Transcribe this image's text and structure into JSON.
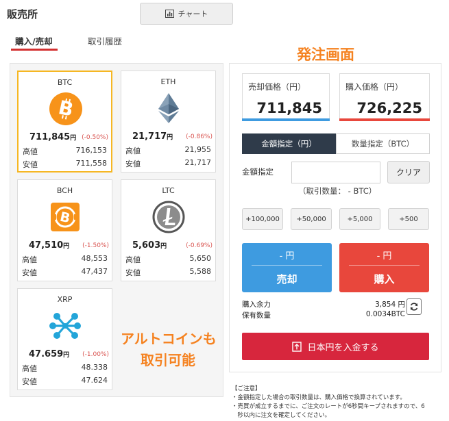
{
  "header": {
    "title": "販売所",
    "chart_button_label": "チャート"
  },
  "tabs": [
    {
      "label": "購入/売却",
      "active": true
    },
    {
      "label": "取引履歴",
      "active": false
    }
  ],
  "annotations": {
    "order_screen": "発注画面",
    "altcoin_line1": "アルトコインも",
    "altcoin_line2": "取引可能"
  },
  "coins": [
    {
      "symbol": "BTC",
      "price": "711,845",
      "unit": "円",
      "change": "(-0.50%)",
      "high_label": "高値",
      "high": "716,153",
      "low_label": "安値",
      "low": "711,558",
      "selected": true,
      "icon": "bitcoin-icon"
    },
    {
      "symbol": "ETH",
      "price": "21,717",
      "unit": "円",
      "change": "(-0.86%)",
      "high_label": "高値",
      "high": "21,955",
      "low_label": "安値",
      "low": "21,717",
      "selected": false,
      "icon": "ethereum-icon"
    },
    {
      "symbol": "BCH",
      "price": "47,510",
      "unit": "円",
      "change": "(-1.50%)",
      "high_label": "高値",
      "high": "48,553",
      "low_label": "安値",
      "low": "47,437",
      "selected": false,
      "icon": "bitcoin-cash-icon"
    },
    {
      "symbol": "LTC",
      "price": "5,603",
      "unit": "円",
      "change": "(-0.69%)",
      "high_label": "高値",
      "high": "5,650",
      "low_label": "安値",
      "low": "5,588",
      "selected": false,
      "icon": "litecoin-icon"
    },
    {
      "symbol": "XRP",
      "price": "47.659",
      "unit": "円",
      "change": "(-1.00%)",
      "high_label": "高値",
      "high": "48.338",
      "low_label": "安値",
      "low": "47.624",
      "selected": false,
      "icon": "ripple-icon"
    }
  ],
  "order": {
    "sell_price_label": "売却価格（円）",
    "sell_price": "711,845",
    "buy_price_label": "購入価格（円）",
    "buy_price": "726,225",
    "mode_amount": "金額指定（円）",
    "mode_quantity": "数量指定（BTC）",
    "amount_label": "金額指定",
    "amount_value": "",
    "clear_label": "クリア",
    "quantity_note": "（取引数量：  - BTC）",
    "quick_amounts": [
      "+100,000",
      "+50,000",
      "+5,000",
      "+500"
    ],
    "sell_button": {
      "yen": "- 円",
      "label": "売却"
    },
    "buy_button": {
      "yen": "- 円",
      "label": "購入"
    },
    "buying_power_label": "購入余力",
    "buying_power": "3,854 円",
    "holdings_label": "保有数量",
    "holdings": "0.0034BTC",
    "deposit_label": "日本円を入金する"
  },
  "notes": {
    "title": "【ご注意】",
    "lines": [
      "・金額指定した場合の取引数量は、購入価格で換算されています。",
      "・売買が成立するまでに、ご注文のレートが6秒間キープされますので、6",
      "　秒以内に注文を確定してください。"
    ]
  },
  "colors": {
    "accent_orange": "#f58220",
    "sell_blue": "#3e9be0",
    "buy_red": "#e8473c",
    "deposit_red": "#d7263d",
    "selected_border": "#f6b723",
    "segment_dark": "#2f3b4a"
  }
}
